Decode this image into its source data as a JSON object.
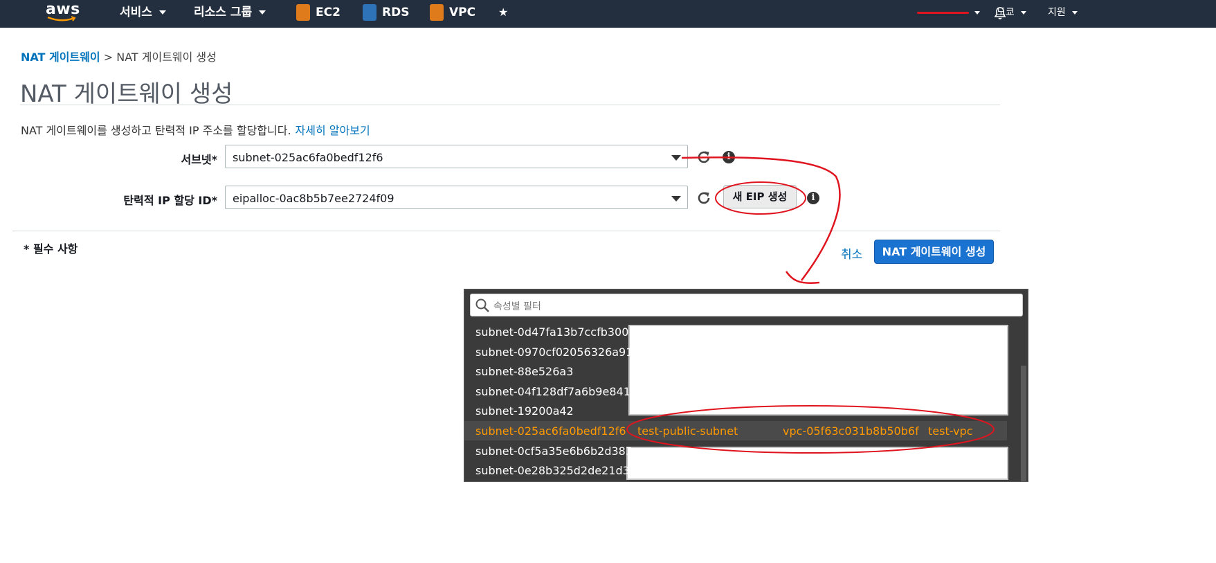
{
  "nav": {
    "logo": "aws",
    "services": "서비스",
    "resource_groups": "리소스 그룹",
    "ec2": "EC2",
    "rds": "RDS",
    "vpc": "VPC",
    "region": "도쿄",
    "support": "지원",
    "colors": {
      "bg": "#232f3e",
      "ec2": "#e07b1c",
      "rds": "#2e73b8",
      "vpc": "#e07b1c"
    }
  },
  "breadcrumb": {
    "parent": "NAT 게이트웨이",
    "separator": ">",
    "current": "NAT 게이트웨이 생성"
  },
  "page": {
    "title": "NAT 게이트웨이 생성",
    "description": "NAT 게이트웨이를 생성하고 탄력적 IP 주소를 할당합니다.",
    "learn_more": "자세히 알아보기"
  },
  "form": {
    "subnet_label": "서브넷*",
    "subnet_value": "subnet-025ac6fa0bedf12f6",
    "eip_label": "탄력적 IP 할당 ID*",
    "eip_value": "eipalloc-0ac8b5b7ee2724f09",
    "new_eip_button": "새 EIP 생성",
    "required_note": "* 필수 사항",
    "cancel": "취소",
    "submit": "NAT 게이트웨이 생성"
  },
  "dropdown": {
    "filter_placeholder": "속성별 필터",
    "options": [
      {
        "id": "subnet-0d47fa13b7ccfb300"
      },
      {
        "id": "subnet-0970cf02056326a91"
      },
      {
        "id": "subnet-88e526a3"
      },
      {
        "id": "subnet-04f128df7a6b9e841"
      },
      {
        "id": "subnet-19200a42"
      },
      {
        "id": "subnet-025ac6fa0bedf12f6",
        "name": "test-public-subnet",
        "vpc": "vpc-05f63c031b8b50b6f",
        "vpc_name": "test-vpc",
        "selected": true
      },
      {
        "id": "subnet-0cf5a35e6b6b2d383"
      },
      {
        "id": "subnet-0e28b325d2de21d38"
      }
    ],
    "highlight_color": "#ff9900"
  },
  "annotation_color": "#e0141e"
}
